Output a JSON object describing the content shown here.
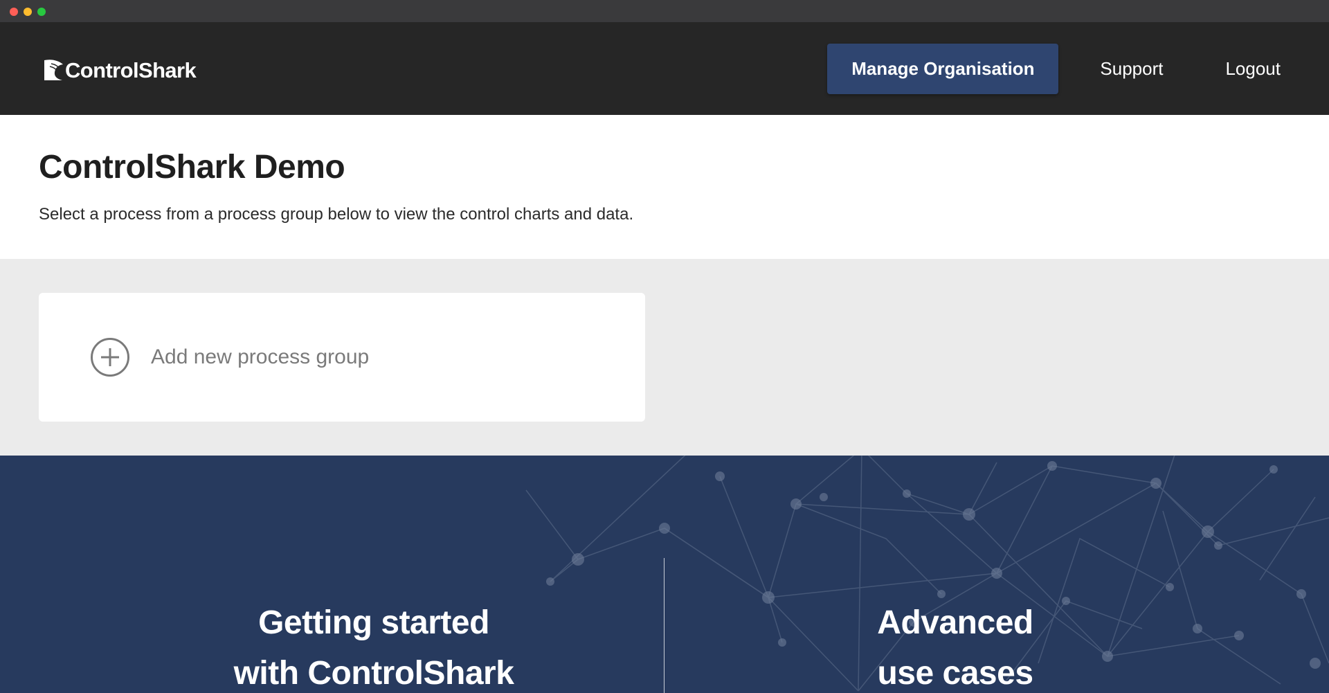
{
  "window": {
    "controls": [
      "close",
      "minimize",
      "maximize"
    ]
  },
  "nav": {
    "brand": "ControlShark",
    "brand_icon": "shark-fin-icon",
    "manage_label": "Manage Organisation",
    "support_label": "Support",
    "logout_label": "Logout"
  },
  "header": {
    "title": "ControlShark Demo",
    "subtitle": "Select a process from a process group below to view the control charts and data."
  },
  "groups": {
    "add_label": "Add new process group",
    "add_icon": "plus-circle-icon"
  },
  "banner": {
    "left_line1": "Getting started",
    "left_line2": "with ControlShark",
    "right_line1": "Advanced",
    "right_line2": "use cases"
  },
  "colors": {
    "nav_bg": "#262626",
    "accent_button": "#2f4570",
    "groups_bg": "#ebebeb",
    "banner_bg": "#273a5e"
  }
}
